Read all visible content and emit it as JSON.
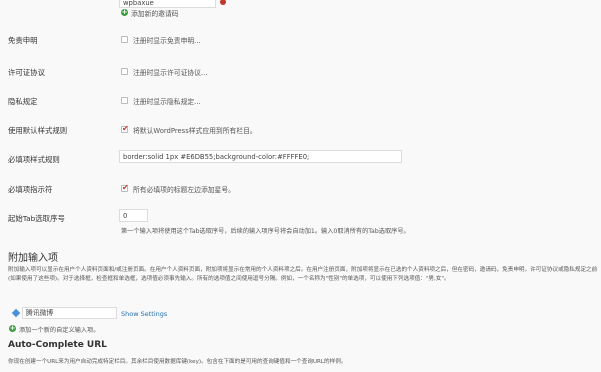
{
  "top_input": {
    "value": "wpbaxue"
  },
  "add_invite_code_label": "添加新的邀请码",
  "rows": {
    "disclaimer": {
      "label": "免责申明",
      "checkbox_text": "注册时显示免责申明..."
    },
    "license": {
      "label": "许可证协议",
      "checkbox_text": "注册时显示许可证协议..."
    },
    "privacy": {
      "label": "隐私规定",
      "checkbox_text": "注册时显示隐私规定..."
    },
    "default_style": {
      "label": "使用默认样式规则",
      "checkbox_text": "将默认WordPress样式应用到所有栏目。"
    },
    "required_style": {
      "label": "必填项样式规则",
      "value": "border:solid 1px #E6DB55;background-color:#FFFFE0;"
    },
    "required_indicator": {
      "label": "必填项指示符",
      "checkbox_text": "所有必填项的标题左边添加星号。"
    },
    "tab_index": {
      "label": "起始Tab选取序号",
      "value": "0",
      "help": "第一个输入项将使用这个Tab选取序号，后续的输入项序号将会自动加1。输入0取消所有的Tab选取序号。"
    }
  },
  "extra_fields": {
    "title": "附加输入项",
    "description": "附加输入项可以显示在用户个人资料页面和/或注册页面。在用户个人资料页面，附加项将显示在常用的个人资料项之后。在用户注册页面，附加项将显示在已选的个人资料项之后，但在密码，邀请码，免责申明，许可证协议或隐私规定之前(如果使用了这些项)。对于选择框，检查框和单选框，选项值必须事先输入。所有的选项值之间使用逗号分隔。例如，一个名称为\"性别\"的单选项，可以使用下列选项值：\"男,女\"。",
    "field_value": "腾讯微博",
    "show_settings": "Show Settings",
    "add_label": "添加一个新的自定义输入项。"
  },
  "autocomplete": {
    "title": "Auto-Complete URL",
    "description": "你现在创建一个URL来为用户自动完成特定栏目。其余栏目使用数据库键(key)。包含在下面的是可用的查询键值和一个查询URL的样例。"
  },
  "colors": {
    "check": "#c0392b",
    "link": "#2271b1",
    "plus": "#3a9d3a"
  }
}
